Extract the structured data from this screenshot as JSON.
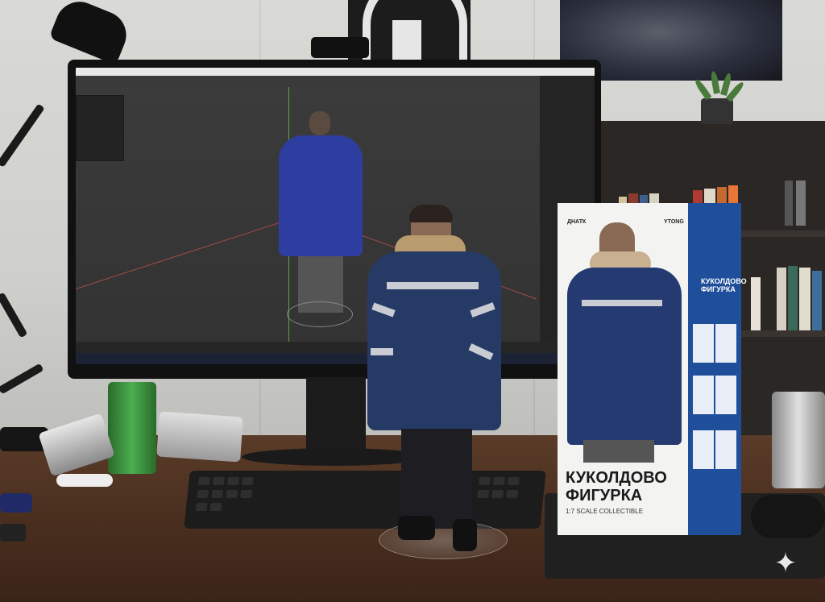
{
  "scene": {
    "description_tag": "desk-photo",
    "box": {
      "brand_left": "ДНАТК",
      "brand_right": "YTONG",
      "title_line1": "КУКОЛДОВО",
      "title_line2": "ФИГУРКА",
      "subtitle": "1:7 SCALE COLLECTIBLE",
      "side_title": "КУКОЛДОВО ФИГУРКА",
      "colors": {
        "front": "#f3f3f1",
        "side": "#1f4f9a"
      }
    },
    "figure": {
      "jacket_color": "#263a66",
      "reflective_stripe": "#c9ccd2"
    },
    "cans": [
      {
        "color": "#3e8f3c"
      },
      {
        "color": "#c8c8c8"
      },
      {
        "color": "#d9d9d9"
      },
      {
        "color": "#b5b5b5"
      }
    ],
    "icons": [
      "sparkle-icon"
    ]
  }
}
